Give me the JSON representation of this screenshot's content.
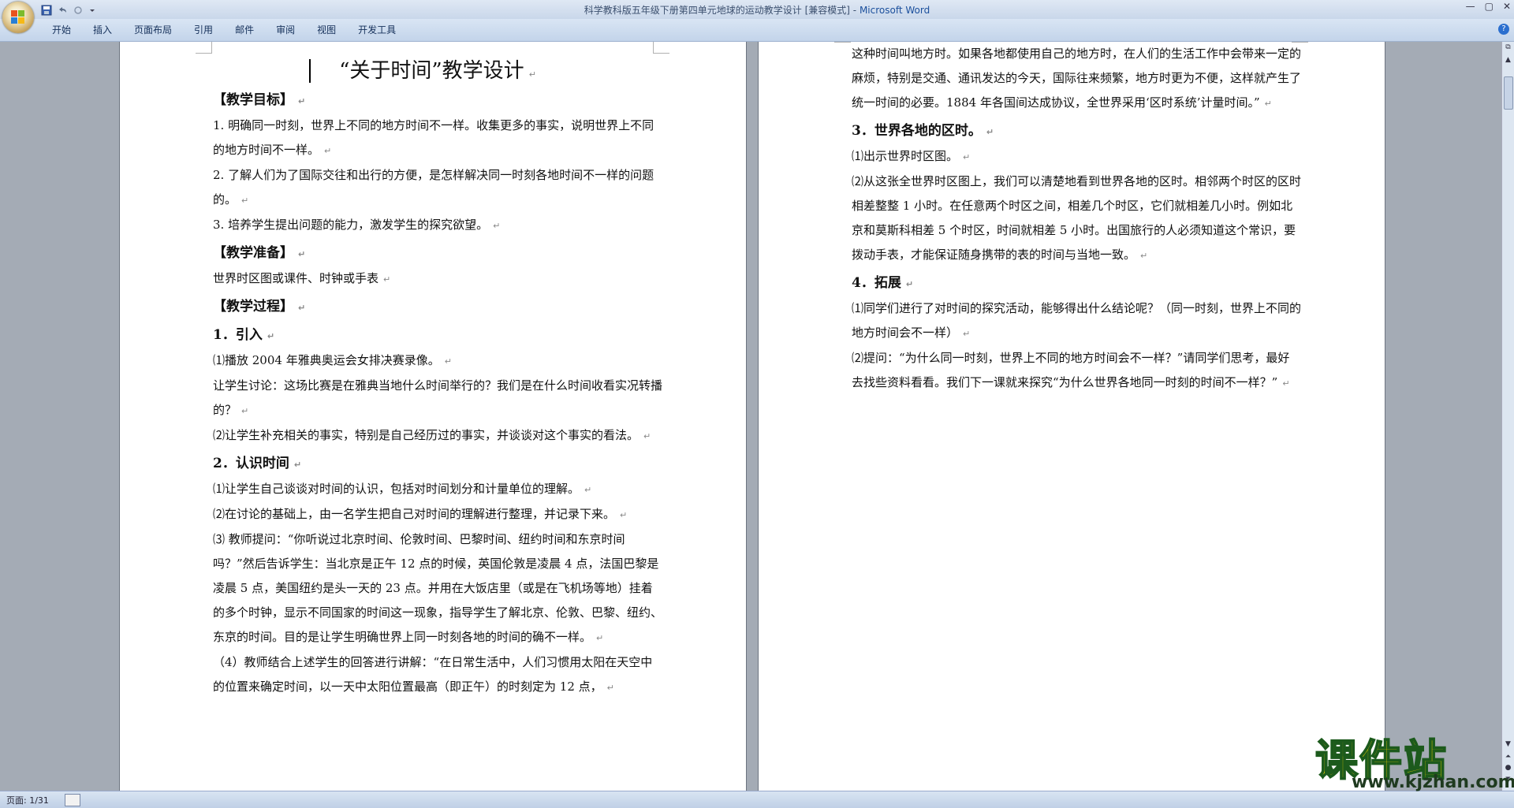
{
  "window": {
    "title_doc": "科学教科版五年级下册第四单元地球的运动教学设计 [兼容模式]",
    "title_sep": " - ",
    "title_app": "Microsoft Word",
    "controls": [
      "—",
      "▢",
      "✕"
    ]
  },
  "ribbon": {
    "tabs": [
      "开始",
      "插入",
      "页面布局",
      "引用",
      "邮件",
      "审阅",
      "视图",
      "开发工具"
    ],
    "help": "?"
  },
  "left_page": {
    "title": "“关于时间”教学设计",
    "blocks": [
      {
        "t": "h",
        "text": "【教学目标】"
      },
      {
        "t": "p",
        "text": "1. 明确同一时刻，世界上不同的地方时间不一样。收集更多的事实，说明世界上不同的地方时间不一样。"
      },
      {
        "t": "p",
        "text": "2. 了解人们为了国际交往和出行的方便，是怎样解决同一时刻各地时间不一样的问题的。"
      },
      {
        "t": "p",
        "text": "3. 培养学生提出问题的能力，激发学生的探究欲望。"
      },
      {
        "t": "h",
        "text": "【教学准备】"
      },
      {
        "t": "p",
        "text": "世界时区图或课件、时钟或手表"
      },
      {
        "t": "h",
        "text": "【教学过程】"
      },
      {
        "t": "h",
        "text": "1．引入"
      },
      {
        "t": "p",
        "text": "⑴播放 2004 年雅典奥运会女排决赛录像。"
      },
      {
        "t": "p",
        "text": "让学生讨论：这场比赛是在雅典当地什么时间举行的？我们是在什么时间收看实况转播的？"
      },
      {
        "t": "p",
        "text": "⑵让学生补充相关的事实，特别是自己经历过的事实，并谈谈对这个事实的看法。"
      },
      {
        "t": "h",
        "text": "2．认识时间"
      },
      {
        "t": "p",
        "text": "⑴让学生自己谈谈对时间的认识，包括对时间划分和计量单位的理解。"
      },
      {
        "t": "p",
        "text": "⑵在讨论的基础上，由一名学生把自己对时间的理解进行整理，并记录下来。"
      },
      {
        "t": "p",
        "text": "⑶ 教师提问：“你听说过北京时间、伦敦时间、巴黎时间、纽约时间和东京时间吗？”然后告诉学生：当北京是正午 12 点的时候，英国伦敦是凌晨 4 点，法国巴黎是凌晨 5 点，美国纽约是头一天的 23 点。并用在大饭店里（或是在飞机场等地）挂着的多个时钟，显示不同国家的时间这一现象，指导学生了解北京、伦敦、巴黎、纽约、东京的时间。目的是让学生明确世界上同一时刻各地的时间的确不一样。"
      },
      {
        "t": "p",
        "text": "（4）教师结合上述学生的回答进行讲解：“在日常生活中，人们习惯用太阳在天空中的位置来确定时间，以一天中太阳位置最高（即正午）的时刻定为 12 点，"
      }
    ]
  },
  "right_page": {
    "blocks": [
      {
        "t": "p",
        "text": "这种时间叫地方时。如果各地都使用自己的地方时，在人们的生活工作中会带来一定的麻烦，特别是交通、通讯发达的今天，国际往来频繁，地方时更为不便，这样就产生了统一时间的必要。1884 年各国间达成协议，全世界采用‘区时系统’计量时间。”"
      },
      {
        "t": "h",
        "text": "3．世界各地的区时。"
      },
      {
        "t": "p",
        "text": "⑴出示世界时区图。"
      },
      {
        "t": "p",
        "text": "⑵从这张全世界时区图上，我们可以清楚地看到世界各地的区时。相邻两个时区的区时相差整整 1 小时。在任意两个时区之间，相差几个时区，它们就相差几小时。例如北京和莫斯科相差 5 个时区，时间就相差 5 小时。出国旅行的人必须知道这个常识，要拨动手表，才能保证随身携带的表的时间与当地一致。"
      },
      {
        "t": "h",
        "text": "4．拓展"
      },
      {
        "t": "p",
        "text": "⑴同学们进行了对时间的探究活动，能够得出什么结论呢？（同一时刻，世界上不同的地方时间会不一样）"
      },
      {
        "t": "p",
        "text": "⑵提问：“为什么同一时刻，世界上不同的地方时间会不一样？”请同学们思考，最好去找些资料看看。我们下一课就来探究“为什么世界各地同一时刻的时间不一样？”"
      }
    ]
  },
  "paragraph_mark": "↵",
  "status": {
    "page": "页面: 1/31"
  },
  "watermark": {
    "text": "课件站",
    "url": "www.kjzhan.com"
  },
  "colors": {
    "title_app": "#1b4f9c",
    "watermark_fill": "#f2d300",
    "watermark_stroke": "#1c5a1c",
    "workspace": "#a4abb5"
  }
}
